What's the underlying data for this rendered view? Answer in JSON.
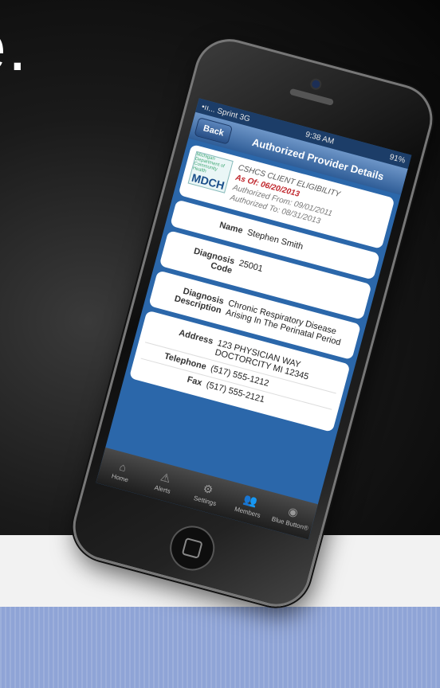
{
  "slide": {
    "title": "e."
  },
  "status_bar": {
    "carrier": "•ıı... Sprint",
    "network": "3G",
    "time": "9:38 AM",
    "battery": "91%"
  },
  "nav": {
    "back_label": "Back",
    "title": "Authorized Provider Details"
  },
  "eligibility": {
    "logo_small": "Michigan Department of Community Health",
    "logo_main": "MDCH",
    "title": "CSHCS CLIENT ELIGIBILITY",
    "as_of": "As Of: 06/20/2013",
    "authorized_from": "Authorized From: 09/01/2011",
    "authorized_to": "Authorized To: 08/31/2013"
  },
  "fields": {
    "name_label": "Name",
    "name_value": "Stephen Smith",
    "diag_code_label": "Diagnosis Code",
    "diag_code_value": "25001",
    "diag_desc_label": "Diagnosis Description",
    "diag_desc_value": "Chronic Respiratory Disease Arising In The Perinatal Period",
    "address_label": "Address",
    "address_value": "123 PHYSICIAN WAY DOCTORCITY MI 12345",
    "telephone_label": "Telephone",
    "telephone_value": "(517) 555-1212",
    "fax_label": "Fax",
    "fax_value": "(517) 555-2121"
  },
  "tabs": [
    {
      "label": "Home",
      "icon": "home-icon"
    },
    {
      "label": "Alerts",
      "icon": "alert-icon"
    },
    {
      "label": "Settings",
      "icon": "gear-icon"
    },
    {
      "label": "Members",
      "icon": "members-icon"
    },
    {
      "label": "Blue Button®",
      "icon": "blue-button-icon"
    }
  ],
  "colors": {
    "nav": "#2f5d97",
    "as_of": "#c0262c",
    "screen_bg": "#2b67aa"
  }
}
